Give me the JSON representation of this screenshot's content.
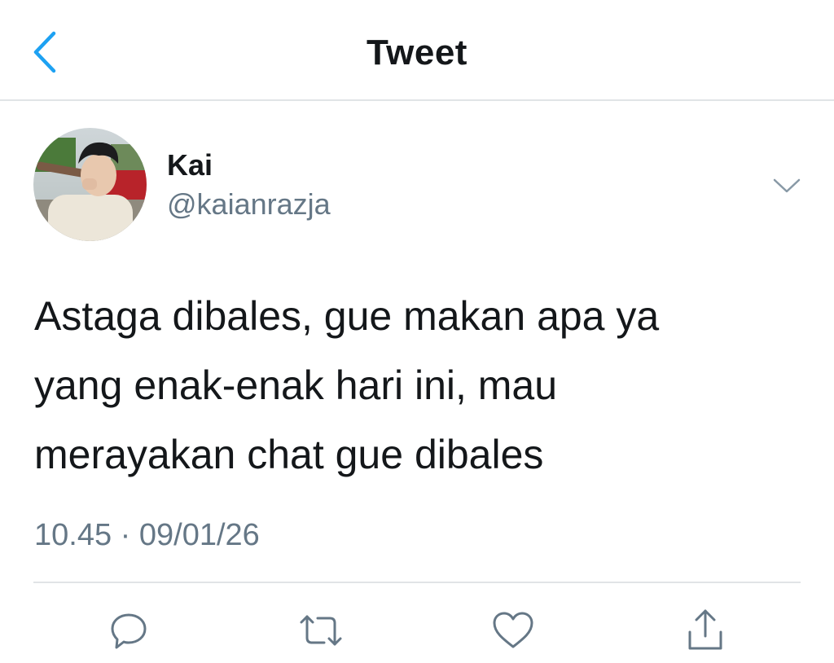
{
  "header": {
    "title": "Tweet",
    "back_icon": "chevron-left-icon"
  },
  "tweet": {
    "display_name": "Kai",
    "handle": "@kaianrazja",
    "text_lines": [
      "Astaga dibales, gue makan apa ya",
      "yang enak-enak hari ini, mau",
      "merayakan chat gue dibales"
    ],
    "timestamp": "10.45 · 09/01/26",
    "caret_icon": "chevron-down-icon"
  },
  "actions": [
    {
      "name": "reply",
      "icon": "reply-icon"
    },
    {
      "name": "retweet",
      "icon": "retweet-icon"
    },
    {
      "name": "like",
      "icon": "heart-icon"
    },
    {
      "name": "share",
      "icon": "share-icon"
    }
  ],
  "colors": {
    "accent": "#1da1f2",
    "text": "#14171a",
    "secondary": "#657786",
    "divider": "#e1e4e6"
  }
}
